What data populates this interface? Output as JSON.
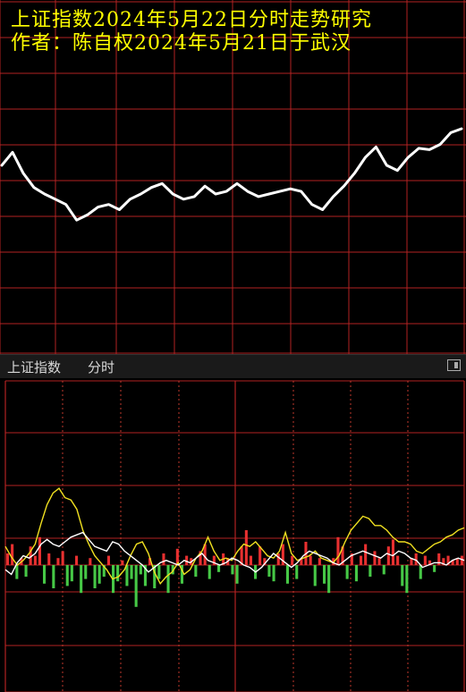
{
  "title": {
    "line1": "上证指数2024年5月22日分时走势研究",
    "line2": "作者：陈自权2024年5月21日于武汉"
  },
  "panel": {
    "name": "上证指数",
    "mode": "分时"
  },
  "colors": {
    "background": "#000000",
    "grid": "#b22222",
    "grid_dotted": "#c0392b",
    "index_line": "#ffffff",
    "yellow_line": "#f0e020",
    "white_line": "#ffffff",
    "bar_up": "#e83030",
    "bar_down": "#46c846"
  },
  "chart_data": [
    {
      "type": "line",
      "series": [
        {
          "values": [
            0.72,
            0.82,
            0.66,
            0.55,
            0.5,
            0.46,
            0.42,
            0.3,
            0.34,
            0.4,
            0.42,
            0.38,
            0.46,
            0.5,
            0.55,
            0.58,
            0.5,
            0.46,
            0.48,
            0.56,
            0.5,
            0.52,
            0.58,
            0.52,
            0.48,
            0.5,
            0.52,
            0.54,
            0.52,
            0.42,
            0.38,
            0.48,
            0.56,
            0.66,
            0.78,
            0.86,
            0.72,
            0.68,
            0.78,
            0.85,
            0.84,
            0.88,
            0.97,
            1.0
          ]
        }
      ]
    },
    {
      "type": "line",
      "series": [
        {
          "values": [
            0.8,
            0.35,
            0.0,
            0.2,
            0.5,
            0.9,
            1.8,
            2.6,
            3.1,
            3.3,
            2.9,
            2.8,
            2.4,
            1.5,
            0.9,
            0.4,
            0.1,
            -0.2,
            -0.6,
            -0.5,
            -0.2,
            0.4,
            0.9,
            1.0,
            0.5,
            -0.3,
            -0.8,
            -0.5,
            -0.3,
            0.1,
            -0.4,
            -0.2,
            0.3,
            0.6,
            1.2,
            0.6,
            0.2,
            0.3,
            0.2,
            0.6,
            0.9,
            0.8,
            1.0,
            0.7,
            0.4,
            0.3,
            0.6,
            1.4,
            0.5,
            0.2,
            0.3,
            0.4,
            0.6,
            0.3,
            0.2,
            0.1,
            0.4,
            1.0,
            1.5,
            1.8,
            2.1,
            2.0,
            1.7,
            1.7,
            1.5,
            1.2,
            1.0,
            1.0,
            0.9,
            0.6,
            0.5,
            0.7,
            0.9,
            1.0,
            1.2,
            1.3,
            1.5,
            1.6
          ]
        },
        {
          "values": [
            -0.2,
            -0.4,
            0.1,
            0.4,
            0.3,
            0.5,
            0.9,
            1.1,
            0.9,
            0.8,
            1.0,
            1.2,
            1.3,
            1.4,
            1.1,
            0.8,
            0.7,
            0.6,
            1.0,
            0.9,
            0.6,
            0.4,
            0.2,
            0.0,
            -0.3,
            -0.1,
            0.1,
            0.2,
            0.1,
            0.0,
            0.2,
            0.1,
            0.3,
            0.5,
            0.2,
            0.1,
            0.0,
            0.1,
            0.3,
            0.2,
            0.0,
            -0.1,
            -0.3,
            -0.1,
            0.2,
            0.5,
            0.3,
            0.1,
            -0.1,
            0.1,
            0.4,
            0.6,
            0.5,
            0.4,
            0.3,
            0.1,
            0.0,
            0.2,
            0.4,
            0.5,
            0.6,
            0.5,
            0.4,
            0.3,
            0.5,
            0.4,
            0.6,
            0.5,
            0.3,
            0.2,
            -0.1,
            0.0,
            0.1,
            0.1,
            0.0,
            0.2,
            0.3,
            0.2
          ]
        },
        {
          "values": [
            0.5,
            0.9,
            -0.6,
            0.3,
            -0.5,
            0.8,
            0.4,
            1.2,
            -0.8,
            0.5,
            -1.0,
            0.3,
            0.6,
            -0.9,
            -0.7,
            0.4,
            -1.2,
            -0.6,
            0.3,
            -1.0,
            -0.8,
            -0.5,
            0.4,
            -1.2,
            -0.7,
            0.2,
            -0.9,
            -0.6,
            -1.8,
            -0.4,
            -0.9,
            0.3,
            -1.0,
            -0.6,
            0.5,
            -1.2,
            -0.4,
            0.7,
            -0.8,
            0.4,
            0.3,
            -0.5,
            0.6,
            0.9,
            -0.6,
            0.4,
            -0.3,
            0.5,
            0.3,
            -0.4,
            -0.8,
            0.8,
            1.5,
            0.4,
            -0.6,
            0.8,
            0.3,
            -0.5,
            -0.7,
            0.5,
            0.9,
            -0.8,
            0.4,
            -0.6,
            0.3,
            1.0,
            0.4,
            -0.9,
            0.3,
            -0.8,
            -1.2,
            0.3,
            1.2,
            0.8,
            -0.6,
            0.5,
            -0.7,
            0.4,
            0.9,
            -0.5,
            0.6,
            0.3,
            -0.4,
            0.8,
            1.1,
            0.4,
            -0.9,
            -1.2,
            0.3,
            0.5,
            -0.6,
            0.4,
            0.2,
            -0.3,
            0.5,
            0.3,
            0.4,
            0.2,
            0.3,
            0.4
          ]
        }
      ]
    }
  ]
}
